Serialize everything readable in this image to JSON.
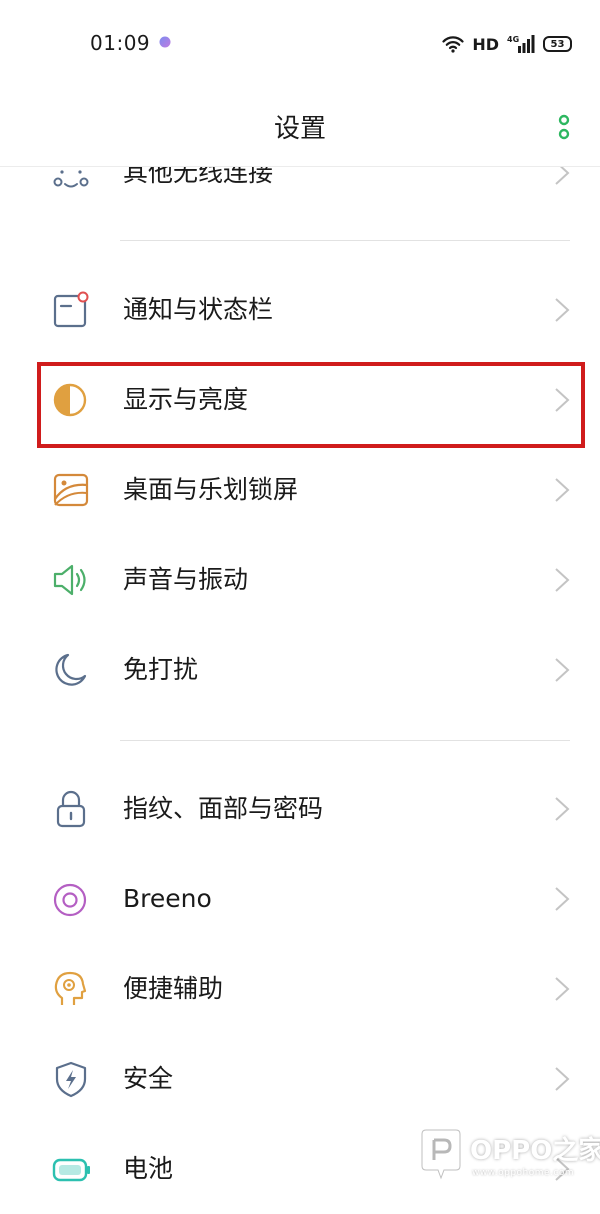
{
  "status_bar": {
    "time": "01:09",
    "network_label": "HD",
    "signal_type": "4G",
    "battery": "53",
    "icons": [
      "assistant-dot-icon",
      "wifi-icon",
      "signal-icon",
      "battery-icon"
    ]
  },
  "header": {
    "title": "设置",
    "more_icon": "more-vertical-icon",
    "accent_color": "#2db760"
  },
  "settings": {
    "items": [
      {
        "label": "其他无线连接",
        "icon": "wireless-connection-icon",
        "color": "#5b6f8c"
      },
      {
        "label": "通知与状态栏",
        "icon": "notification-icon",
        "color": "#5b6f8c"
      },
      {
        "label": "显示与亮度",
        "icon": "display-brightness-icon",
        "color": "#e0a040"
      },
      {
        "label": "桌面与乐划锁屏",
        "icon": "wallpaper-icon",
        "color": "#d4893a"
      },
      {
        "label": "声音与振动",
        "icon": "speaker-icon",
        "color": "#4caf6a"
      },
      {
        "label": "免打扰",
        "icon": "moon-icon",
        "color": "#5b6f8c"
      },
      {
        "label": "指纹、面部与密码",
        "icon": "lock-icon",
        "color": "#5b6f8c"
      },
      {
        "label": "Breeno",
        "icon": "breeno-icon",
        "color": "#b45fc3"
      },
      {
        "label": "便捷辅助",
        "icon": "assistive-head-icon",
        "color": "#e0a040"
      },
      {
        "label": "安全",
        "icon": "shield-icon",
        "color": "#5b6f8c"
      },
      {
        "label": "电池",
        "icon": "battery-setting-icon",
        "color": "#2cc0b0"
      }
    ]
  },
  "annotation": {
    "highlight_color": "#d01c1c",
    "target": "显示与亮度"
  },
  "watermark": {
    "name": "OPPO之家",
    "url": "www.oppohome.com"
  }
}
